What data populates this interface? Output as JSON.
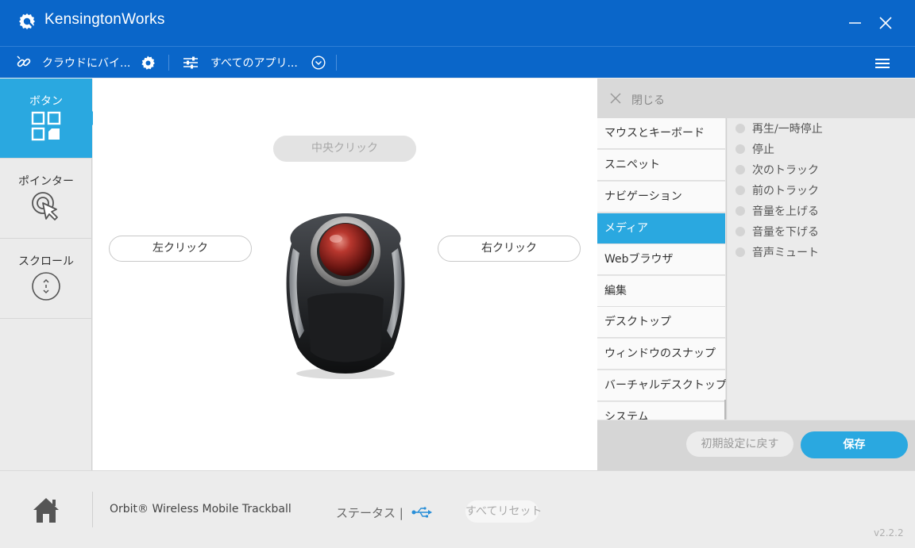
{
  "app": {
    "title": "KensingtonWorks",
    "version": "v2.2.2"
  },
  "toolbar": {
    "cloud_label": "クラウドにバイ...",
    "app_select_label": "すべてのアプリ..."
  },
  "sidenav": {
    "items": [
      {
        "label": "ボタン",
        "active": true
      },
      {
        "label": "ポインター",
        "active": false
      },
      {
        "label": "スクロール",
        "active": false
      }
    ]
  },
  "canvas": {
    "middle_click": "中央クリック",
    "left_click": "左クリック",
    "right_click": "右クリック"
  },
  "panel": {
    "close_label": "閉じる",
    "categories": [
      {
        "label": "マウスとキーボード",
        "active": false
      },
      {
        "label": "スニペット",
        "active": false
      },
      {
        "label": "ナビゲーション",
        "active": false
      },
      {
        "label": "メディア",
        "active": true
      },
      {
        "label": "Webブラウザ",
        "active": false
      },
      {
        "label": "編集",
        "active": false
      },
      {
        "label": "デスクトップ",
        "active": false
      },
      {
        "label": "ウィンドウのスナップ",
        "active": false
      },
      {
        "label": "バーチャルデスクトップ",
        "active": false
      },
      {
        "label": "システム",
        "active": false
      }
    ],
    "options": [
      "再生/一時停止",
      "停止",
      "次のトラック",
      "前のトラック",
      "音量を上げる",
      "音量を下げる",
      "音声ミュート"
    ],
    "reset_label": "初期設定に戻す",
    "save_label": "保存"
  },
  "bottom": {
    "device_name": "Orbit® Wireless Mobile Trackball",
    "status_label": "ステータス |",
    "reset_all_label": "すべてリセット"
  },
  "colors": {
    "primary": "#0a66c9",
    "accent": "#2aa8e0"
  }
}
